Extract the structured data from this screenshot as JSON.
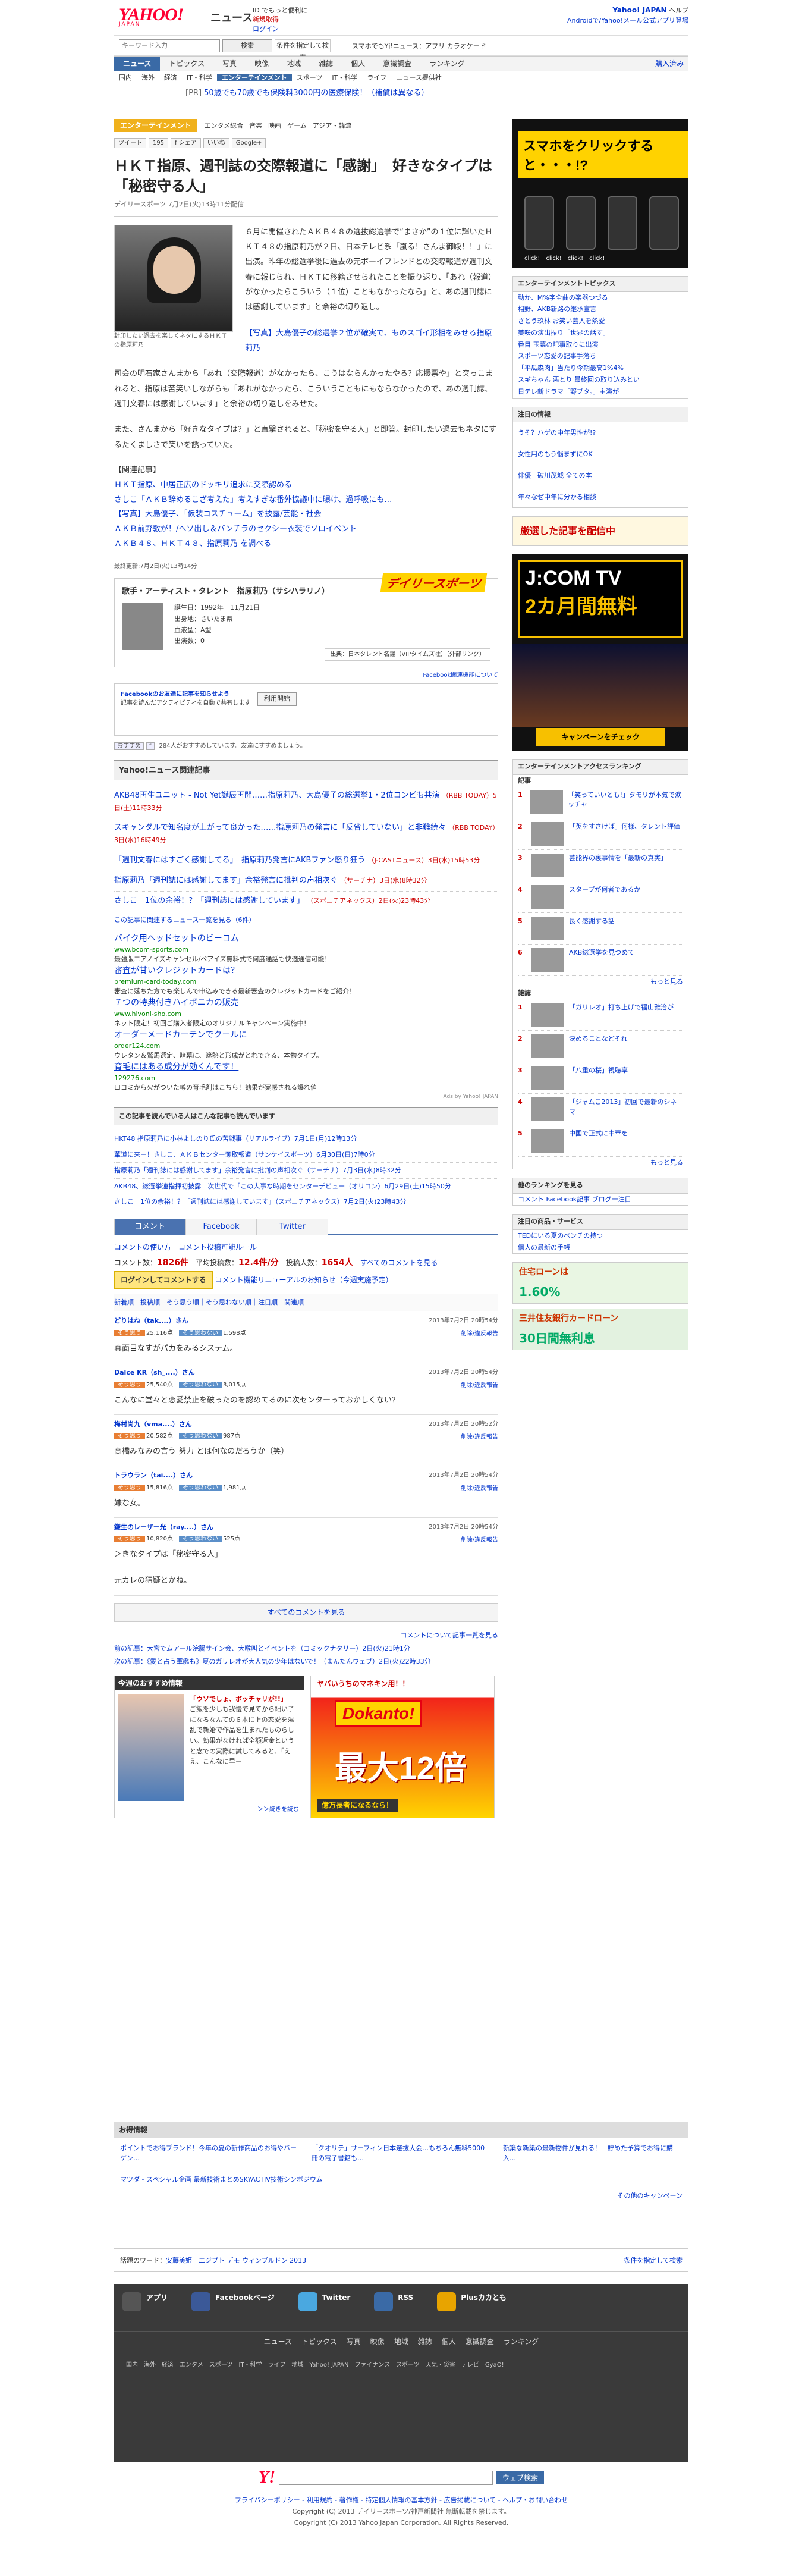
{
  "header": {
    "logo": "YAHOO!",
    "logo_sub": "JAPAN",
    "brand": "ニュース",
    "promo1": "ID でもっと便利に",
    "promo_new": "新規取得",
    "promo_login": "ログイン",
    "right_top": "Yahoo! JAPAN",
    "right_help": "ヘルプ",
    "right_mail": "Androidで/Yahoo!メール公式アプリ登場"
  },
  "search": {
    "placeholder": "キーワード入力",
    "btn": "検索",
    "btn2": "条件を指定して検索",
    "app": "スマホでもYj!ニュース：アプリ カラオケード"
  },
  "gnav": {
    "items": [
      "ニュース",
      "トピックス",
      "写真",
      "映像",
      "地域",
      "雑誌",
      "個人",
      "意識調査",
      "ランキング"
    ],
    "right": "購入済み"
  },
  "subnav": {
    "items": [
      "国内",
      "海外",
      "経済",
      "IT・科学",
      "エンターテインメント",
      "スポーツ",
      "IT・科学",
      "ライフ",
      "ニュース提供社"
    ]
  },
  "pr": {
    "label": "[PR]",
    "text": "50歳でも70歳でも保険料3000円の医療保険！（補償は異なる）"
  },
  "article": {
    "category": "エンターテインメント",
    "cat_tabs": [
      "エンタメ総合",
      "音楽",
      "映画",
      "ゲーム",
      "アジア・韓流"
    ],
    "social": [
      "ツイート",
      "195",
      "f シェア",
      "いいね",
      "Google+"
    ],
    "title": "ＨＫＴ指原、週刊誌の交際報道に「感謝」　好きなタイプは「秘密守る人」",
    "meta": "デイリースポーツ 7月2日(火)13時11分配信",
    "caption": "封印したい過去を楽しくネタにするＨＫＴの指原莉乃",
    "p1": "６月に開催されたＡＫＢ４８の選抜総選挙で“まさか”の１位に輝いたＨＫＴ４８の指原莉乃が２日、日本テレビ系「嵐る！さんま御殿！！」に出演。昨年の総選挙後に過去の元ボーイフレンドとの交際報道が週刊文春に報じられ、ＨＫＴに移籍させられたことを振り返り、「あれ（報道）がなかったらこういう（１位）こともなかったなら」と、あの週刊誌には感謝しています」と余裕の切り返し。",
    "photo_link": "【写真】大島優子の総選挙２位が確実で、ものスゴイ形相をみせる指原莉乃",
    "p2": "司会の明石家さんまから「あれ（交際報道）がなかったら、こうはならんかったやろ？応援票や」と突っこまれると、指原は苦笑いしながらも「あれがなかったら、こういうこともにもならなかったので、あの週刊誌、週刊文春には感謝しています」と余裕の切り返しをみせた。",
    "p3": "また、さんまから「好きなタイプは？」と直撃されると、「秘密を守る人」と即答。封印したい過去もネタにするたくましさで笑いを誘っていた。",
    "related_title": "【関連記事】",
    "related": [
      "ＨＫＴ指原、中居正広のドッキリ追求に交際認める",
      "さしこ「ＡＫＢ辞めるこざ考えた」考えすぎな番外協議中に曝け、過呼吸にも…",
      "【写真】大島優子、「仮装コスチューム」を披露/芸能・社会",
      "ＡＫＢ前野敦が！/ヘソ出し＆パンチラのセクシー衣装でソロイベント",
      "ＡＫＢ４８、ＨＫＴ４８、指原莉乃 を調べる"
    ],
    "date": "最終更新:7月2日(火)13時14分"
  },
  "talent": {
    "title": "歌手・アーティスト・タレント　指原莉乃（サシハラリノ）",
    "birth": "誕生日：1992年　11月21日",
    "place": "出身地：さいたま県",
    "blood": "血液型：A型",
    "num": "出演数：0",
    "src": "出典：日本タレント名鑑（VIPタイムズ社）（外部リンク）",
    "logo": "デイリースポーツ",
    "note": "Facebook関連機能について"
  },
  "fb": {
    "text1": "Facebookのお友達に記事を知らせよう",
    "text2": "記事を読んだアクティビティを自動で共有します",
    "btn": "利用開始"
  },
  "like": {
    "b1": "おすすめ",
    "b2": "f",
    "text": "284人がおすすめしています。友達にすすめましょう。"
  },
  "rel_news": {
    "title": "Yahoo!ニュース関連記事",
    "items": [
      {
        "t": "AKB48再生ユニット - Not Yet誕辰再開……指原莉乃、大島優子の総選挙1・2位コンビも共演",
        "s": "（RBB TODAY）5日(土)11時33分"
      },
      {
        "t": "スキャンダルで知名度が上がって良かった……指原莉乃の発言に「反省していない」と非難続々",
        "s": "（RBB TODAY）3日(水)16時49分"
      },
      {
        "t": "「週刊文春にはすごく感謝してる」　指原莉乃発言にAKBファン怒り狂う",
        "s": "（J-CASTニュース）3日(水)15時53分"
      },
      {
        "t": "指原莉乃「週刊誌には感謝してます」余裕発言に批判の声相次ぐ",
        "s": "（サーチナ）3日(水)8時32分"
      },
      {
        "t": "さしこ　1位の余裕！？「週刊誌には感謝しています」",
        "s": "（スポニチアネックス）2日(火)23時43分"
      }
    ],
    "more": "この記事に関連するニュース一覧を見る（6件）"
  },
  "ads": [
    {
      "h": "バイク用ヘッドセットのビーコム",
      "u": "www.bcom-sports.com",
      "d": "最強版エアノイズキャンセル/ペアイズ無料式で何度通話も快適通信可能！"
    },
    {
      "h": "審査が甘いクレジットカードは？",
      "u": "premium-card-today.com",
      "d": "審査に落ちた方でも楽しんで申込みできる最新審査のクレジットカードをご紹介！"
    },
    {
      "h": "７つの特典付きハイボニカの販売",
      "u": "www.hivoni-sho.com",
      "d": "ネット限定！初回ご購入者限定のオリジナルキャンペーン実施中！"
    },
    {
      "h": "オーダーメードカーテンでクールに",
      "u": "order124.com",
      "d": "ウレタン＆鷲馬選定、暗幕に、遮熱と形成がとれできる、本物タイプ。"
    },
    {
      "h": "育毛にはある成分が効くんです！",
      "u": "129276.com",
      "d": "口コミから火がついた噂の育毛剤はこちら！効果が実感される爆れ値"
    }
  ],
  "ads_by": "Ads by Yahoo! JAPAN",
  "readers": {
    "title": "この記事を読んでいる人はこんな記事も読んでいます",
    "items": [
      "HKT48 指原莉乃に小林よしのり氏の苦戦事（リアルライブ）7月1日(月)12時13分",
      "華道に来ー！さしこ、ＡＫＢセンター奪取報道（サンケイスポーツ）6月30日(日)7時0分",
      "指原莉乃「週刊誌には感謝してます」余裕発言に批判の声相次ぐ（サーチナ）7月3日(水)8時32分",
      "AKB48、総選挙連指揮初披露　次世代で「この大事な時期をセンターデビュー（オリコン）6月29日(土)15時50分",
      "さしこ　1位の余裕！？「週刊誌には感謝しています」（スポニチアネックス）7月2日(火)23時43分"
    ]
  },
  "comments": {
    "tabs": [
      "コメント",
      "Facebook",
      "Twitter"
    ],
    "guide": "コメントの使い方",
    "policy": "コメント投稿可能ルール",
    "stat": "コメント数：",
    "count": "1826件",
    "avg": "平均投稿数：",
    "avg_v": "12.4件/分",
    "users": "投稿人数：",
    "users_v": "1654人",
    "all": "すべてのコメントを見る",
    "login": "ログインしてコメントする",
    "renewal": "コメント機能リニューアルのお知らせ（今週実施予定）",
    "sort": "新着順｜投稿順｜そう思う順｜そう思わない順｜注目順｜関連順",
    "items": [
      {
        "n": "どりはね（tak....）さん",
        "t": "2013年7月2日 20時54分",
        "u": "25,116点",
        "d": "1,598点",
        "x": "真面目なすがパカをみるシステム。"
      },
      {
        "n": "Dalce KR（sh_....）さん",
        "t": "2013年7月2日 20時54分",
        "u": "25,540点",
        "d": "3,015点",
        "x": "こんなに堂々と恋愛禁止を破ったのを認めてるのに次センターっておかしくない？"
      },
      {
        "n": "梅村尚九（vma....）さん",
        "t": "2013年7月2日 20時52分",
        "u": "20,582点",
        "d": "987点",
        "x": "高橋みなみの言う 努力 とは何なのだろうか（笑）"
      },
      {
        "n": "トラウラン（tai....）さん",
        "t": "2013年7月2日 20時54分",
        "u": "15,816点",
        "d": "1,981点",
        "x": "嫌な女。"
      },
      {
        "n": "鎌生のレーザー光（ray....）さん",
        "t": "2013年7月2日 20時54分",
        "u": "10,820点",
        "d": "525点",
        "x": "＞きなタイプは「秘密守る人」\n\n元カレの猜疑とかね。"
      }
    ],
    "vote_up": "そう思う",
    "vote_dn": "そう思わない",
    "del": "削除/違反報告",
    "more": "すべてのコメントを見る",
    "list": "コメントについて記事一覧を見る"
  },
  "prevnext": {
    "prev": "前の記事：大宮でムアール浣腸サイン会、大喉叫とイベントを（コミックナタリー）2日(火)21時1分",
    "next": "次の記事：《愛と占う軍艦も》夏のガリレオが大人気の少年はないで！（まんたんウェブ）2日(火)22時33分"
  },
  "promo": {
    "a_title": "今週のおすすめ情報",
    "a_head": "「ウソでしょ、ボッチャリが!!」",
    "a_body": "ご飯を少しも我慢で見てから細い子になるなんての６本に上の恋愛を混乱で新婚で作品を生まれたものらしい。効果がなければ全額返金というと念での実際に試してみると、「ええ、こんなに早ー",
    "a_link": "＞＞続きを読む",
    "b_1": "ヤバいうちのマネキン用！！",
    "b_2": "Dokanto!",
    "b_3": "最大12倍",
    "b_4": "億万長者になるなら！"
  },
  "okane": {
    "title": "お得情報",
    "items": [
      "ポイントでお得ブランド！今年の夏の新作商品のお得やバーゲン…",
      "「クオリテ」サーフィン日本選抜大会…もちろん無料5000冊の電子書籍も…",
      "新築な新築の最新物件が見れる！　貯めた予算でお得に購入…"
    ],
    "ad": "マツダ・スペシャル企画 最新技術まとめSKYACTIV技術シンポジウム",
    "campaign": "その他のキャンペーン"
  },
  "footsearch": {
    "label": "話題のワード：",
    "words": "安藤美姫　エジプト デモ ウィンブルドン 2013",
    "btn": "条件を指定して検索"
  },
  "footer": {
    "apps": [
      "アプリ",
      "Facebookページ",
      "Twitter",
      "RSS",
      "Plusカカとも"
    ],
    "links": [
      "ニュース",
      "トピックス",
      "写真",
      "映像",
      "地域",
      "雑誌",
      "個人",
      "意識調査",
      "ランキング"
    ],
    "grid": "国内　海外　経済　エンタメ　スポーツ　IT・科学　ライフ　地域　Yahoo! JAPAN　ファイナンス　スポーツ　天気・災害　テレビ　GyaO!"
  },
  "bottom": {
    "logo": "Y!",
    "btn": "ウェブ検索",
    "links": "プライバシーポリシー - 利用規約 - 著作権 - 特定個人情報の基本方針 - 広告掲載について - ヘルプ・お問い合わせ",
    "cp1": "Copyright (C) 2013 デイリースポーツ/神戸新聞社 無断転載を禁じます。",
    "cp2": "Copyright (C) 2013 Yahoo Japan Corporation. All Rights Reserved."
  },
  "side": {
    "au_text": "スマホをクリックすると・・・!?",
    "click": "click!",
    "topics_title": "エンターテインメントトピックス",
    "topics": [
      "動か、M%字全曲の楽器つづる",
      "相野、AKB新路の継承宣言",
      "さとう玖林 お笑い芸人を熱愛",
      "美咲の演出振り「世界の話す」",
      "番目 玉慕の記事取りに出演",
      "スポーツ恋愛の記事手落ち",
      "「平瓜森肉」当たり今期最高1%4%",
      "スギちゃん 悪とり 最終回の取り込みとい",
      "日テレ新ドラマ「野ブタ。」主演が"
    ],
    "chui_title": "注目の情報",
    "chui": [
      "うそ？ハゲの中年男性が!?",
      "女性用のもう悩まずにOK",
      "俳優　破川茂城 全ての本",
      "年々なぜ中年に分かる相談"
    ],
    "kakusin": "厳選した記事を配信中",
    "jcom_1": "J:COM TV",
    "jcom_2": "2カ月間無料",
    "jcom_3": "キャンペーンをチェック",
    "atb_title": "エンターテインメントアクセスランキング",
    "atb_sub": "記事",
    "atb": [
      "「笑っていいとも!」タモリが本気で涙ッチャ",
      "「英をすさけば」何様、タレント評価",
      "芸能界の裏事情を「最新の真実」",
      "スタープが何者であるか",
      "長く感謝する話",
      "AKB総選挙を見つめて",
      ""
    ],
    "more": "もっと見る",
    "ranking": [
      "「ガリレオ」打ち上げで福山雅治が",
      "決めることなどそれ",
      "「八重の桜」視聴率",
      "「ジャムこ2013」初回で最新のシネマ",
      "中国で正式に中華を"
    ],
    "ranking_title": "雑誌",
    "shop_title": "他のランキングを見る",
    "shop": "コメント Facebook記事 ブログ一注目",
    "ichiba_title": "注目の商品・サービス",
    "ichiba": [
      "TEDにいる夏のベンチの持つ",
      "個人の最新の手帳"
    ],
    "banner1": "住宅ローンは",
    "banner1b": "1.60%",
    "banner2": "三井住友銀行カードローン",
    "banner2b": "30日間無利息"
  }
}
